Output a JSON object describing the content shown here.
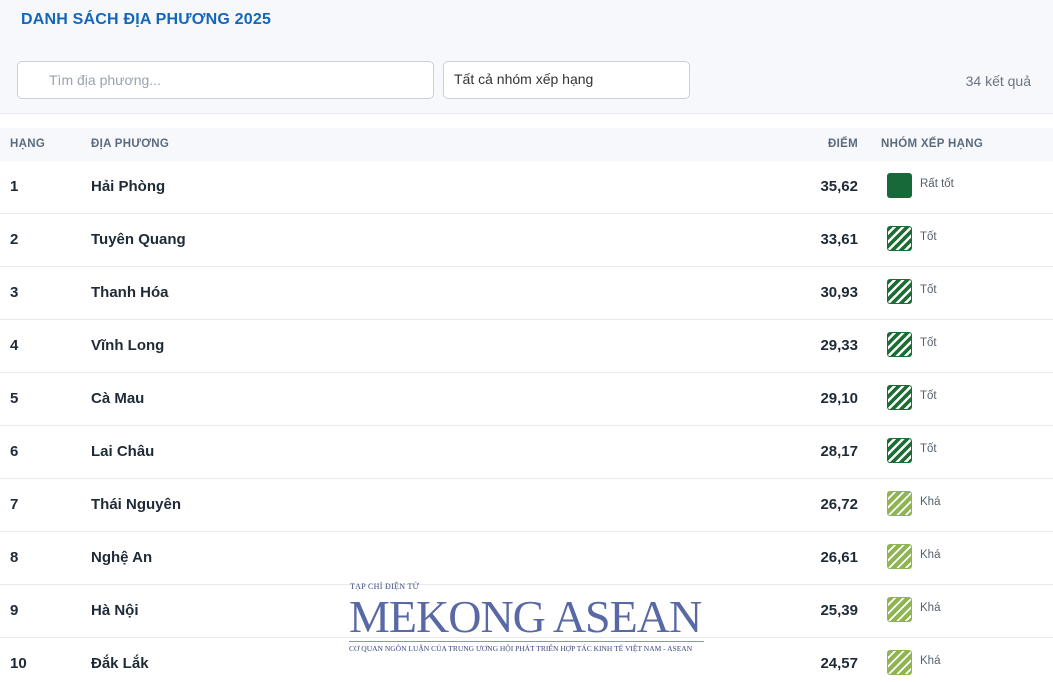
{
  "header": {
    "title": "DANH SÁCH ĐỊA PHƯƠNG 2025"
  },
  "search": {
    "placeholder": "Tìm địa phương..."
  },
  "filter": {
    "selected": "Tất cả nhóm xếp hạng"
  },
  "result_count": "34 kết quả",
  "table": {
    "columns": {
      "rank": "HẠNG",
      "name": "ĐỊA PHƯƠNG",
      "score": "ĐIỂM",
      "group": "NHÓM XẾP HẠNG"
    },
    "rows": [
      {
        "rank": "1",
        "name": "Hải Phòng",
        "score": "35,62",
        "group": "Rất tốt",
        "swatch": "sw-rattot"
      },
      {
        "rank": "2",
        "name": "Tuyên Quang",
        "score": "33,61",
        "group": "Tốt",
        "swatch": "sw-tot"
      },
      {
        "rank": "3",
        "name": "Thanh Hóa",
        "score": "30,93",
        "group": "Tốt",
        "swatch": "sw-tot"
      },
      {
        "rank": "4",
        "name": "Vĩnh Long",
        "score": "29,33",
        "group": "Tốt",
        "swatch": "sw-tot"
      },
      {
        "rank": "5",
        "name": "Cà Mau",
        "score": "29,10",
        "group": "Tốt",
        "swatch": "sw-tot"
      },
      {
        "rank": "6",
        "name": "Lai Châu",
        "score": "28,17",
        "group": "Tốt",
        "swatch": "sw-tot"
      },
      {
        "rank": "7",
        "name": "Thái Nguyên",
        "score": "26,72",
        "group": "Khá",
        "swatch": "sw-kha"
      },
      {
        "rank": "8",
        "name": "Nghệ An",
        "score": "26,61",
        "group": "Khá",
        "swatch": "sw-kha"
      },
      {
        "rank": "9",
        "name": "Hà Nội",
        "score": "25,39",
        "group": "Khá",
        "swatch": "sw-kha"
      },
      {
        "rank": "10",
        "name": "Đắk Lắk",
        "score": "24,57",
        "group": "Khá",
        "swatch": "sw-kha"
      }
    ]
  },
  "watermark": {
    "top": "TẠP CHÍ ĐIỆN TỬ",
    "brand": "MEKONG ASEAN",
    "sub": "CƠ QUAN NGÔN LUẬN CỦA TRUNG ƯƠNG HỘI PHÁT TRIỂN HỢP TÁC KINH TẾ VIỆT NAM - ASEAN"
  },
  "colors": {
    "title": "#1466b8",
    "rat_tot": "#17693a",
    "tot": "#1b6e33",
    "kha": "#8fb553"
  }
}
